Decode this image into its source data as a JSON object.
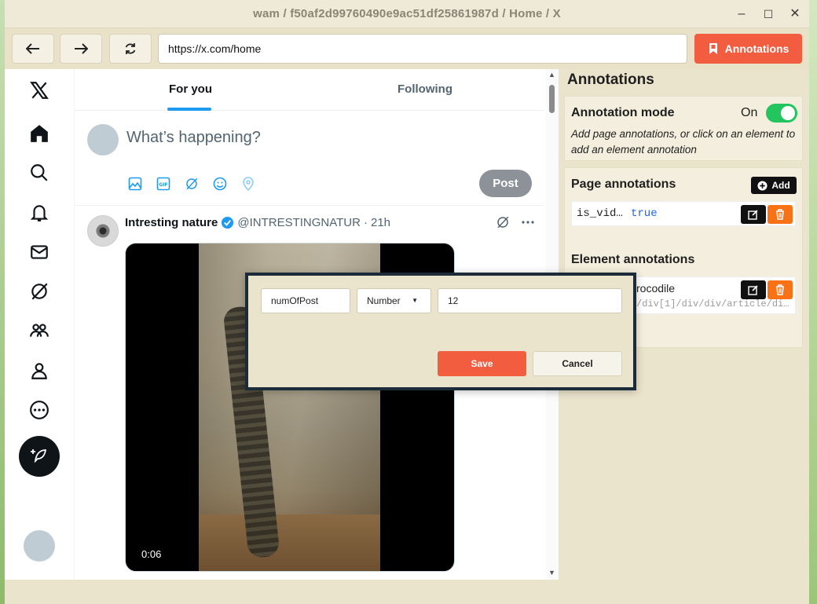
{
  "window": {
    "title": "wam / f50af2d99760490e9ac51df25861987d / Home / X",
    "minimize_glyph": "–",
    "maximize_glyph": "☐",
    "close_glyph": "✕"
  },
  "toolbar": {
    "back_icon": "arrow-left-icon",
    "forward_icon": "arrow-right-icon",
    "reload_icon": "reload-icon",
    "url": "https://x.com/home",
    "annotations_label": "Annotations"
  },
  "x": {
    "nav_icons": [
      "x-logo-icon",
      "home-icon",
      "search-icon",
      "bell-icon",
      "mail-icon",
      "grok-icon",
      "communities-icon",
      "profile-icon",
      "more-icon"
    ],
    "tabs": [
      "For you",
      "Following"
    ],
    "composer": {
      "placeholder": "What’s happening?",
      "post_label": "Post",
      "tools": [
        "image-icon",
        "gif-icon",
        "grok-icon",
        "emoji-icon",
        "location-icon"
      ]
    },
    "post": {
      "name": "Intresting nature",
      "handle": "@INTRESTINGNATUR",
      "time": "21h",
      "separator": "·",
      "video_time": "0:06"
    }
  },
  "panel": {
    "title": "Annotations",
    "mode_label": "Annotation mode",
    "mode_state": "On",
    "mode_hint": "Add page annotations, or click on an element to add an element annotation",
    "page_section_title": "Page annotations",
    "add_label": "Add",
    "page_annotations": [
      {
        "key": "is_vid…",
        "value": "true"
      }
    ],
    "element_section_title": "Element annotations",
    "element_annotations": [
      {
        "name": "rocodile",
        "path": "/div[1]/div/div/article/di…"
      }
    ]
  },
  "dialog": {
    "key_value": "numOfPost",
    "type_value": "Number",
    "value_value": "12",
    "save_label": "Save",
    "cancel_label": "Cancel"
  },
  "colors": {
    "accent": "#f25c3f",
    "toggle_on": "#22c55e",
    "x_blue": "#1d9bf0",
    "delete": "#f97316"
  }
}
